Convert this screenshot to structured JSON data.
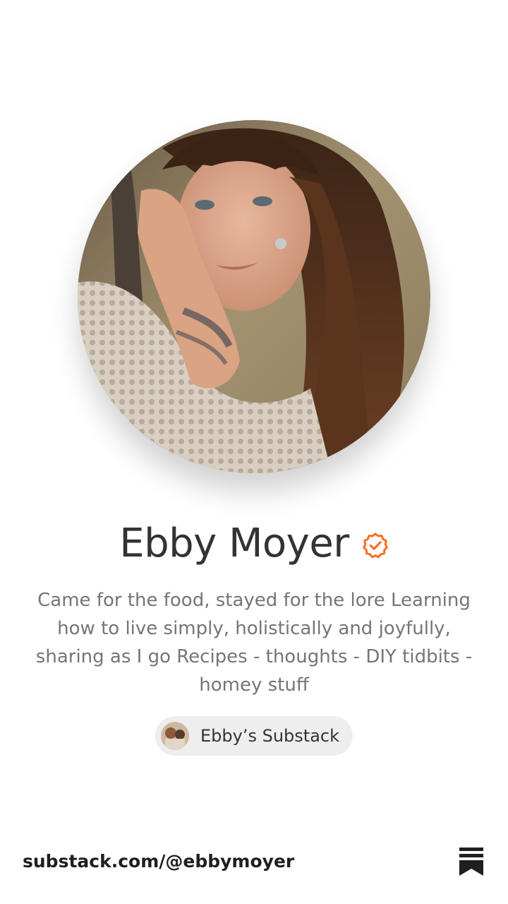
{
  "profile": {
    "name": "Ebby Moyer",
    "bio": "Came for the food, stayed for the lore Learning how to live simply, holistically and joyfully, sharing as I go Recipes - thoughts - DIY tidbits - homey stuff",
    "verified_icon": "verified-check-icon",
    "accent_color": "#FF6719"
  },
  "publication": {
    "name": "Ebby’s Substack"
  },
  "footer": {
    "url": "substack.com/@ebbymoyer",
    "logo_icon": "substack-logo-icon"
  }
}
